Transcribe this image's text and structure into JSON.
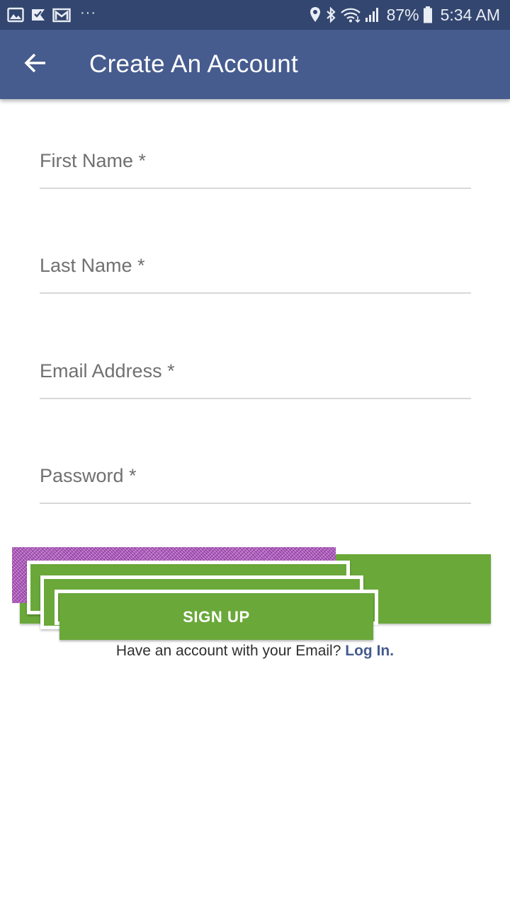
{
  "status_bar": {
    "battery": "87%",
    "time": "5:34 AM",
    "icons": [
      "gallery-icon",
      "checkmark-flag-icon",
      "gmail-icon",
      "more-dots-icon",
      "location-icon",
      "bluetooth-icon",
      "wifi-icon",
      "signal-icon",
      "battery-icon"
    ],
    "more": "···"
  },
  "header": {
    "title": "Create An Account",
    "back_icon": "arrow-left-icon"
  },
  "form": {
    "first_name_placeholder": "First Name *",
    "last_name_placeholder": "Last Name *",
    "email_placeholder": "Email Address *",
    "password_placeholder": "Password *"
  },
  "actions": {
    "signup_label": "SIGN UP",
    "login_prompt": "Have an account with your Email?",
    "login_link": "Log In."
  },
  "colors": {
    "status_bar": "#33466f",
    "app_bar": "#465b8e",
    "button_green": "#6aa83a",
    "link": "#465b8e"
  }
}
